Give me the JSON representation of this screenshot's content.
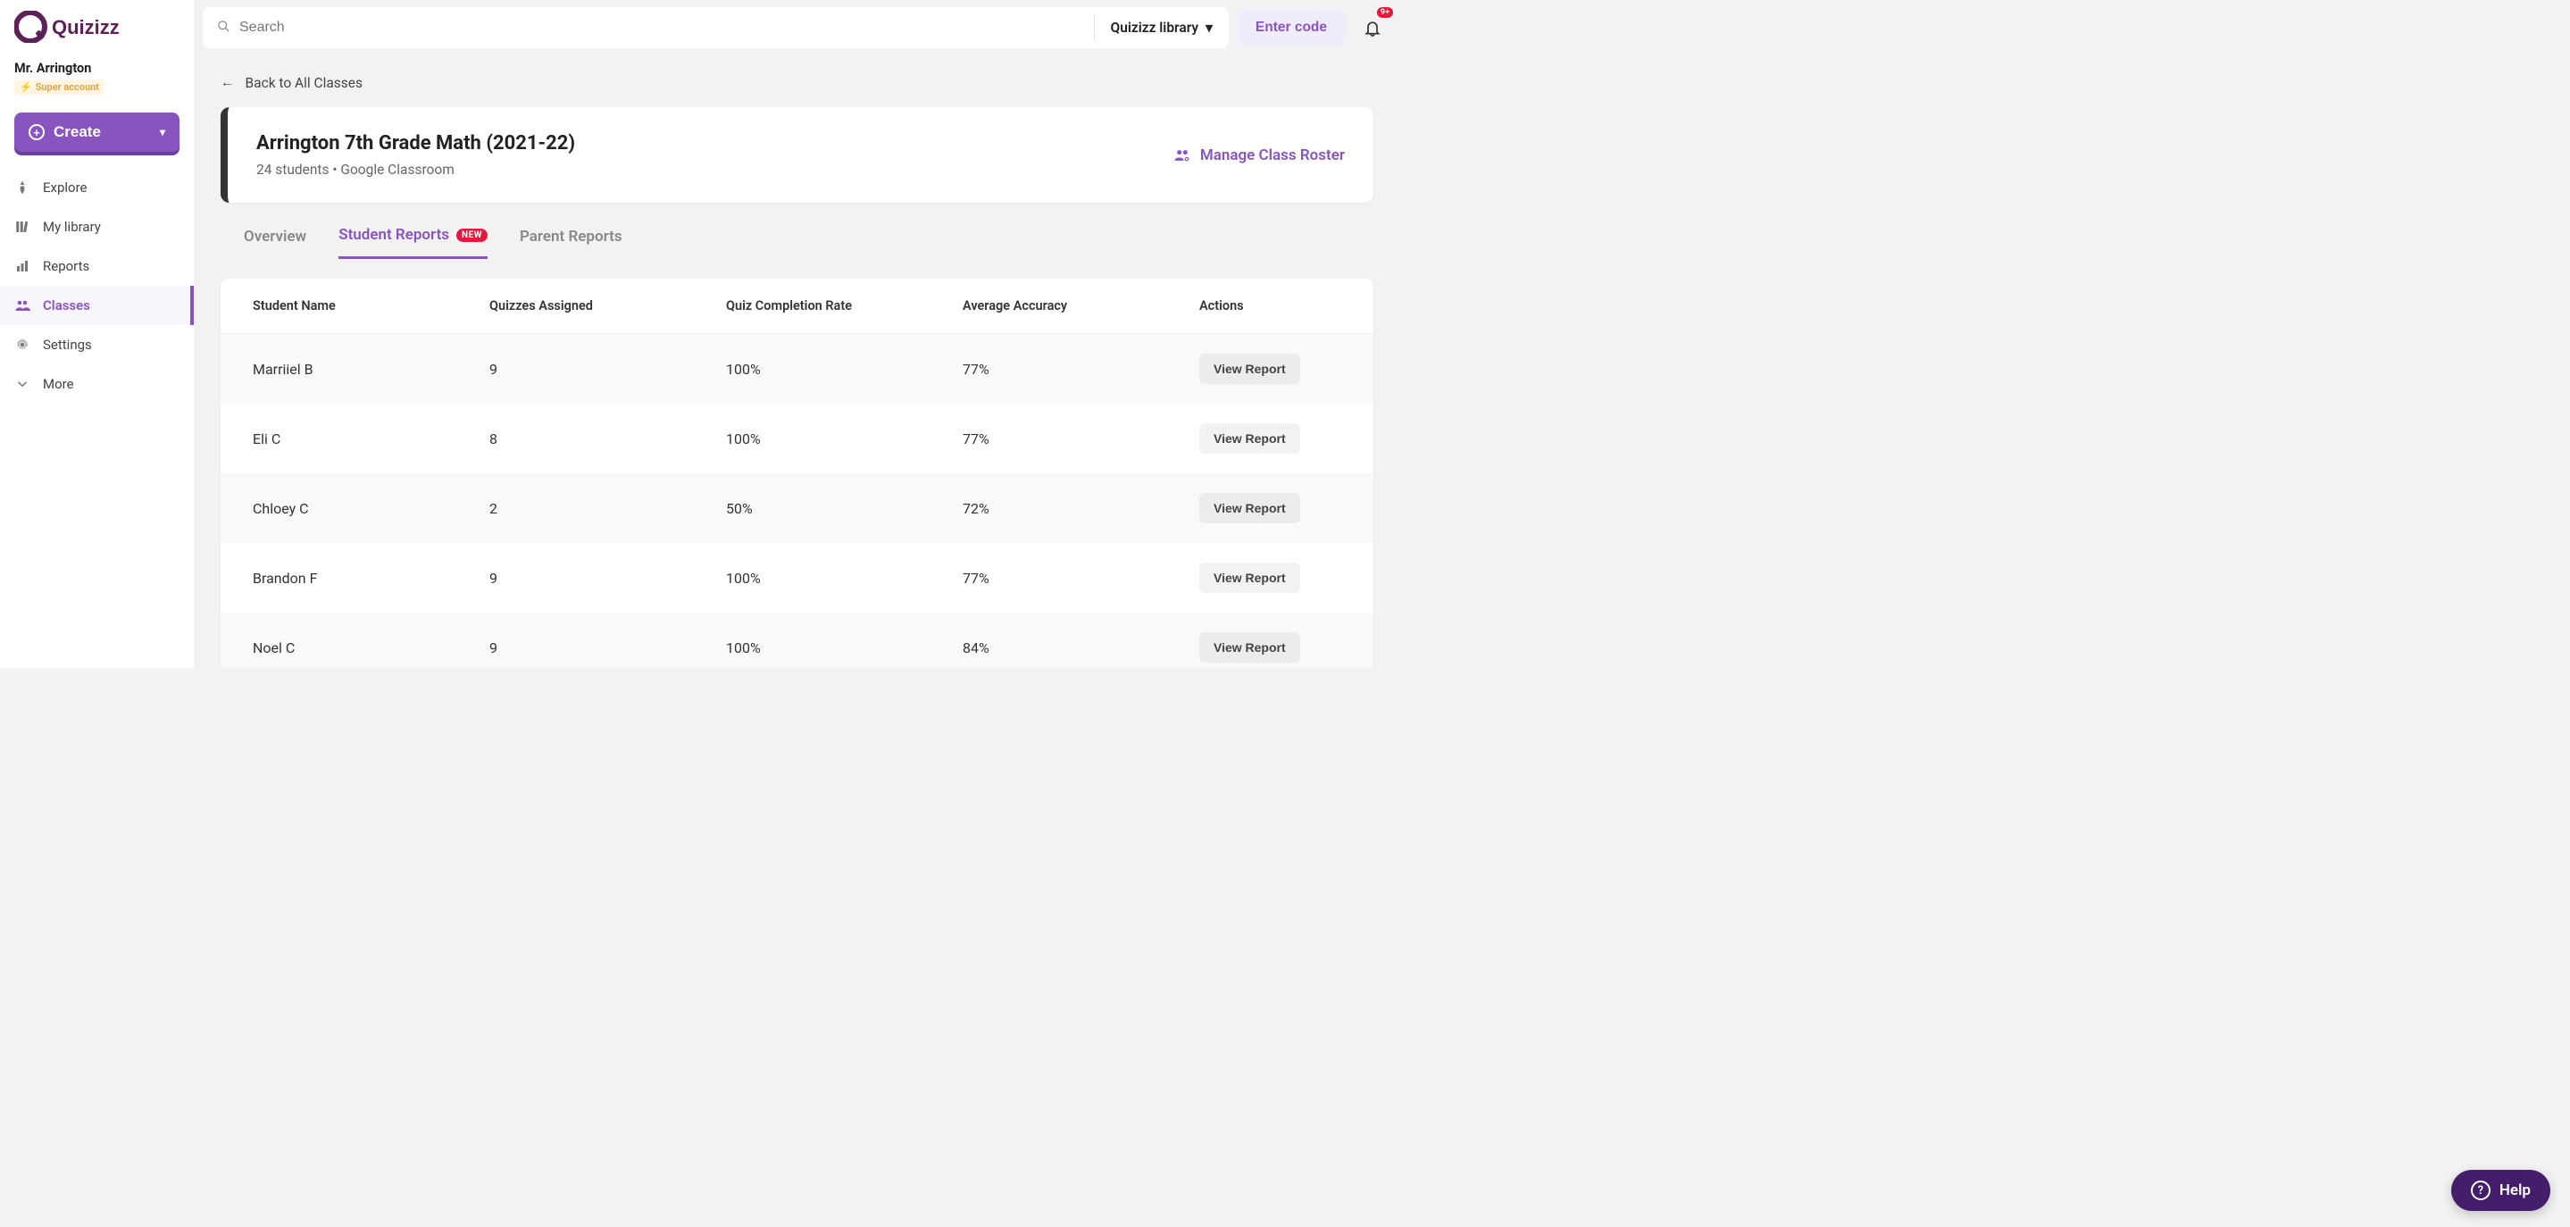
{
  "brand": "Quizizz",
  "user": {
    "name": "Mr. Arrington",
    "badge": "Super account"
  },
  "create_label": "Create",
  "sidebar": {
    "items": [
      {
        "label": "Explore"
      },
      {
        "label": "My library"
      },
      {
        "label": "Reports"
      },
      {
        "label": "Classes"
      },
      {
        "label": "Settings"
      },
      {
        "label": "More"
      }
    ]
  },
  "search": {
    "placeholder": "Search"
  },
  "library_dropdown": "Quizizz library",
  "enter_code": "Enter code",
  "notif_badge": "9+",
  "back_link": "Back to All Classes",
  "class": {
    "title": "Arrington 7th Grade Math (2021-22)",
    "subtitle": "24 students  •  Google Classroom",
    "manage": "Manage Class Roster"
  },
  "tabs": {
    "overview": "Overview",
    "student_reports": "Student Reports",
    "new_badge": "NEW",
    "parent_reports": "Parent Reports"
  },
  "columns": {
    "name": "Student Name",
    "assigned": "Quizzes Assigned",
    "completion": "Quiz Completion Rate",
    "accuracy": "Average Accuracy",
    "actions": "Actions"
  },
  "view_report": "View Report",
  "rows": [
    {
      "name": "Marriiel B",
      "assigned": "9",
      "completion": "100%",
      "accuracy": "77%"
    },
    {
      "name": "Eli C",
      "assigned": "8",
      "completion": "100%",
      "accuracy": "77%"
    },
    {
      "name": "Chloey C",
      "assigned": "2",
      "completion": "50%",
      "accuracy": "72%"
    },
    {
      "name": "Brandon F",
      "assigned": "9",
      "completion": "100%",
      "accuracy": "77%"
    },
    {
      "name": "Noel C",
      "assigned": "9",
      "completion": "100%",
      "accuracy": "84%"
    }
  ],
  "help": "Help"
}
